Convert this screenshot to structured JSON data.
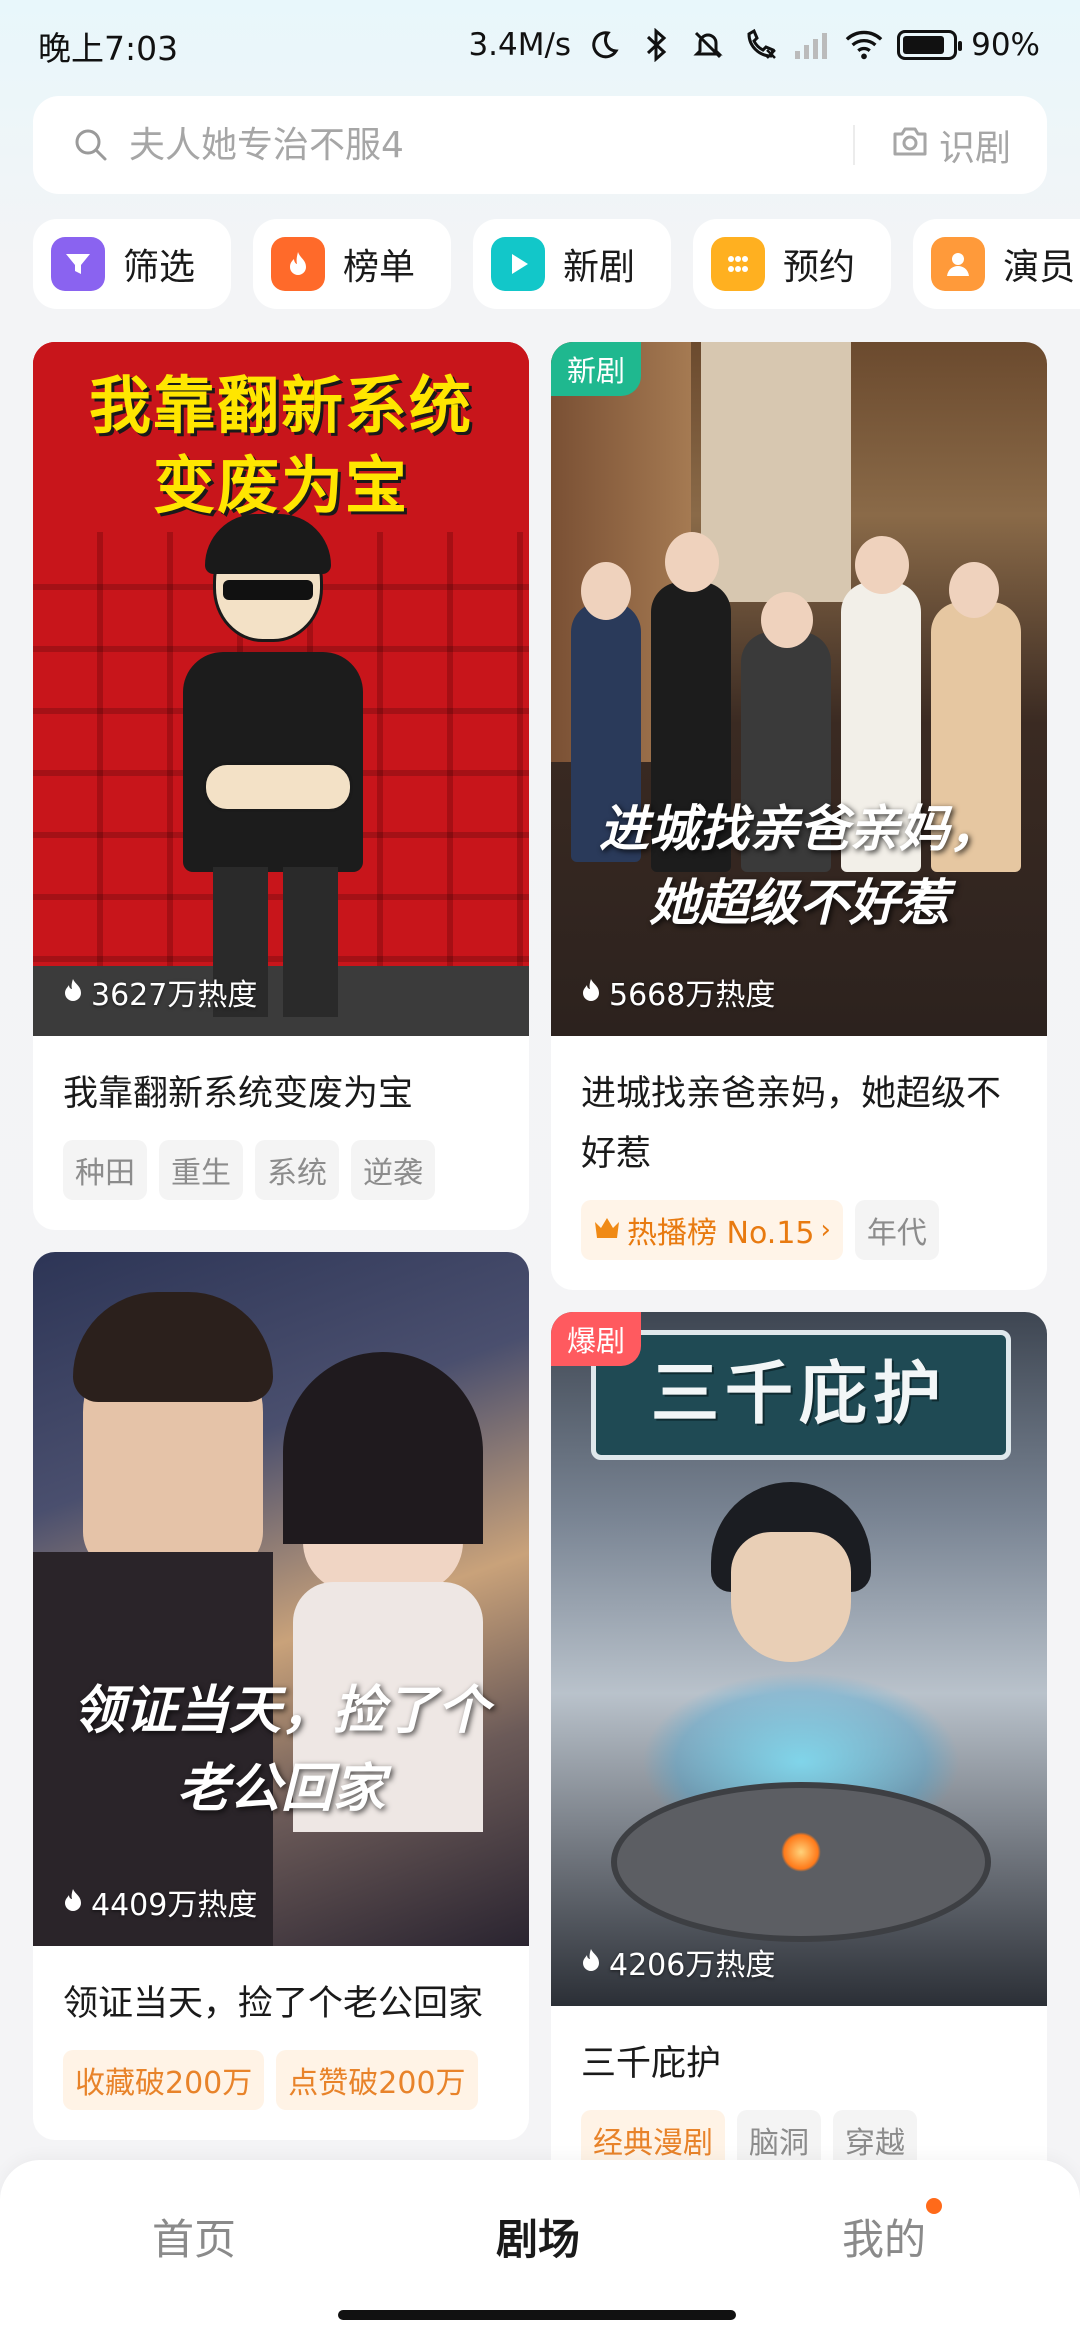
{
  "status_bar": {
    "time": "晚上7:03",
    "speed": "3.4M/s",
    "battery": "90%",
    "icons": [
      "moon-icon",
      "bluetooth-icon",
      "mute-icon",
      "call-icon",
      "signal-icon",
      "wifi-icon",
      "battery-icon"
    ]
  },
  "search": {
    "placeholder": "夫人她专治不服4",
    "recognize_label": "识剧"
  },
  "chips": [
    {
      "label": "筛选",
      "icon": "filter-icon",
      "color": "#8a63f0"
    },
    {
      "label": "榜单",
      "icon": "flame-icon",
      "color": "#ff6a2a"
    },
    {
      "label": "新剧",
      "icon": "play-icon",
      "color": "#12c7c9"
    },
    {
      "label": "预约",
      "icon": "grid-dots-icon",
      "color": "#ffb020"
    },
    {
      "label": "演员",
      "icon": "person-icon",
      "color": "#ff9a3a"
    }
  ],
  "cards": {
    "c1": {
      "poster_title": "我靠翻新系统变废为宝",
      "heat": "3627万热度",
      "title": "我靠翻新系统变废为宝",
      "tags": [
        "种田",
        "重生",
        "系统",
        "逆袭"
      ]
    },
    "c2": {
      "badge": "新剧",
      "poster_title": "进城找亲爸亲妈，她超级不好惹",
      "heat": "5668万热度",
      "title": "进城找亲爸亲妈，她超级不好惹",
      "rank": "热播榜 No.15",
      "tags": [
        "年代"
      ]
    },
    "c3": {
      "poster_title": "领证当天，捡了个老公回家",
      "heat": "4409万热度",
      "title": "领证当天，捡了个老公回家",
      "tags": [
        "收藏破200万",
        "点赞破200万"
      ]
    },
    "c4": {
      "badge": "爆剧",
      "poster_title": "三千庇护",
      "heat": "4206万热度",
      "title": "三千庇护",
      "tags": [
        "经典漫剧",
        "脑洞",
        "穿越"
      ]
    }
  },
  "nav": {
    "home": "首页",
    "theater": "剧场",
    "mine": "我的"
  }
}
